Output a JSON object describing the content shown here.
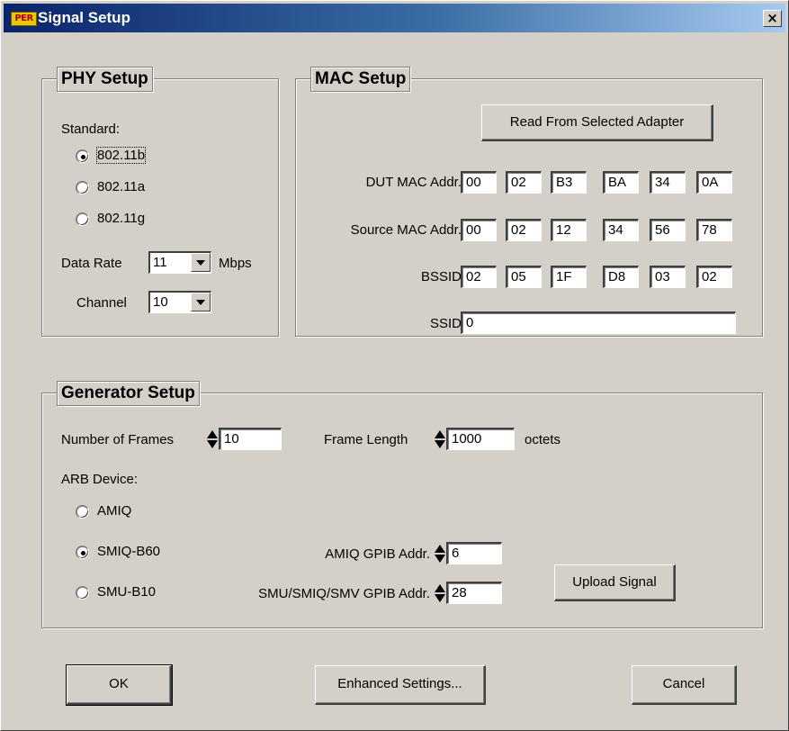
{
  "window": {
    "app_icon_text": "PER",
    "title": "Signal Setup",
    "close_label": "×"
  },
  "phy": {
    "title": "PHY Setup",
    "standard_label": "Standard:",
    "standards": [
      {
        "label": "802.11b",
        "selected": true
      },
      {
        "label": "802.11a",
        "selected": false
      },
      {
        "label": "802.11g",
        "selected": false
      }
    ],
    "data_rate_label": "Data Rate",
    "data_rate_value": "11",
    "data_rate_unit": "Mbps",
    "channel_label": "Channel",
    "channel_value": "10"
  },
  "mac": {
    "title": "MAC Setup",
    "read_button": "Read From Selected Adapter",
    "dut_label": "DUT MAC Addr.",
    "dut_octets": [
      "00",
      "02",
      "B3",
      "BA",
      "34",
      "0A"
    ],
    "source_label": "Source MAC Addr.",
    "source_octets": [
      "00",
      "02",
      "12",
      "34",
      "56",
      "78"
    ],
    "bssid_label": "BSSID",
    "bssid_octets": [
      "02",
      "05",
      "1F",
      "D8",
      "03",
      "02"
    ],
    "ssid_label": "SSID",
    "ssid_value": "0"
  },
  "generator": {
    "title": "Generator Setup",
    "frames_label": "Number of Frames",
    "frames_value": "10",
    "frame_length_label": "Frame Length",
    "frame_length_value": "1000",
    "frame_length_unit": "octets",
    "arb_label": "ARB Device:",
    "arb_devices": [
      {
        "label": "AMIQ",
        "selected": false
      },
      {
        "label": "SMIQ-B60",
        "selected": true
      },
      {
        "label": "SMU-B10",
        "selected": false
      }
    ],
    "amiq_gpib_label": "AMIQ GPIB Addr.",
    "amiq_gpib_value": "6",
    "smu_gpib_label": "SMU/SMIQ/SMV GPIB Addr.",
    "smu_gpib_value": "28",
    "upload_button": "Upload Signal"
  },
  "buttons": {
    "ok": "OK",
    "enhanced": "Enhanced Settings...",
    "cancel": "Cancel"
  },
  "colors": {
    "face": "#d4d0c8",
    "title_start": "#0a246a",
    "title_end": "#a6caf0"
  }
}
